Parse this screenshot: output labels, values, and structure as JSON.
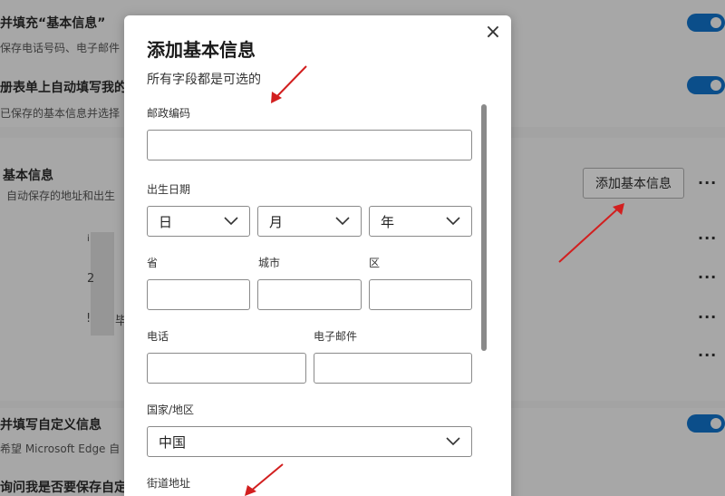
{
  "background": {
    "rows": [
      {
        "title": "并填充“基本信息”",
        "subtitle": "保存电话号码、电子邮件"
      },
      {
        "title": "册表单上自动填写我的",
        "subtitle": "已保存的基本信息并选择"
      },
      {
        "title": "基本信息",
        "subtitle": "自动保存的地址和出生"
      },
      {
        "title": "并填写自定义信息",
        "subtitle": "希望 Microsoft Edge 自"
      },
      {
        "title": "询问我是否要保存自定",
        "subtitle": ""
      }
    ],
    "add_button_label": "添加基本信息",
    "more_label": "···",
    "blur_chars": [
      "2",
      "!",
      "毕",
      "i"
    ]
  },
  "dialog": {
    "title": "添加基本信息",
    "subtitle": "所有字段都是可选的",
    "close_label": "×",
    "postal_code": {
      "label": "邮政编码",
      "value": ""
    },
    "birth_date": {
      "label": "出生日期",
      "day": "日",
      "month": "月",
      "year": "年"
    },
    "province": {
      "label": "省",
      "value": ""
    },
    "city": {
      "label": "城市",
      "value": ""
    },
    "district": {
      "label": "区",
      "value": ""
    },
    "phone": {
      "label": "电话",
      "value": ""
    },
    "email": {
      "label": "电子邮件",
      "value": ""
    },
    "country": {
      "label": "国家/地区",
      "value": "中国"
    },
    "street": {
      "label": "街道地址"
    }
  },
  "colors": {
    "toggle": "#0b4e8a",
    "arrow": "#d21f1f",
    "overlay": "#a3a3a3"
  }
}
